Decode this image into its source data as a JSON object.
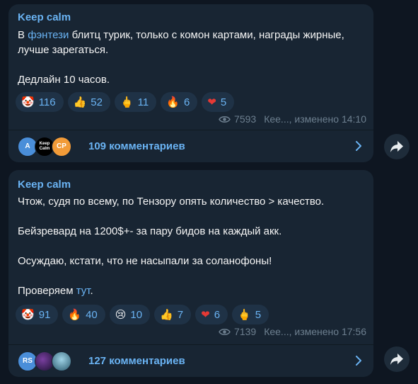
{
  "posts": [
    {
      "author": "Keep calm",
      "lines": {
        "intro_prefix": "В ",
        "intro_link": "фэнтези",
        "intro_rest": " блитц турик, только с комон картами, награды жирные, лучше зарегаться.",
        "deadline": "Дедлайн 10 часов."
      },
      "reactions": [
        {
          "emoji": "🤡",
          "count": "116"
        },
        {
          "emoji": "👍",
          "count": "52"
        },
        {
          "emoji": "🖕",
          "count": "11"
        },
        {
          "emoji": "🔥",
          "count": "6"
        },
        {
          "emoji": "❤",
          "count": "5"
        }
      ],
      "views": "7593",
      "signature": "Кее..., изменено 14:10",
      "avatars": [
        "A",
        "Keep Calm",
        "CP"
      ],
      "comments": "109 комментариев"
    },
    {
      "author": "Keep calm",
      "lines": {
        "p1": "Чтож, судя по всему, по Тензору опять количество > качество.",
        "p2": "Бейзревард на 1200$+- за пару бидов на каждый акк.",
        "p3": "Осуждаю, кстати, что не насыпали за соланофоны!",
        "p4_prefix": "Проверяем ",
        "p4_link": "тут",
        "p4_suffix": "."
      },
      "reactions": [
        {
          "emoji": "🤡",
          "count": "91"
        },
        {
          "emoji": "🔥",
          "count": "40"
        },
        {
          "emoji": "😢",
          "count": "10"
        },
        {
          "emoji": "👍",
          "count": "7"
        },
        {
          "emoji": "❤",
          "count": "6"
        },
        {
          "emoji": "🖕",
          "count": "5"
        }
      ],
      "views": "7139",
      "signature": "Кее..., изменено 17:56",
      "avatars": [
        "RS",
        "",
        ""
      ],
      "comments": "127 комментариев"
    }
  ],
  "colors": {
    "background": "#0e1621",
    "bubble": "#182533",
    "accent": "#6ab3f3",
    "meta": "#6d7f8f"
  },
  "icons": {
    "views": "eye-icon",
    "open_comments": "chevron-right-icon",
    "share": "share-arrow-icon"
  }
}
